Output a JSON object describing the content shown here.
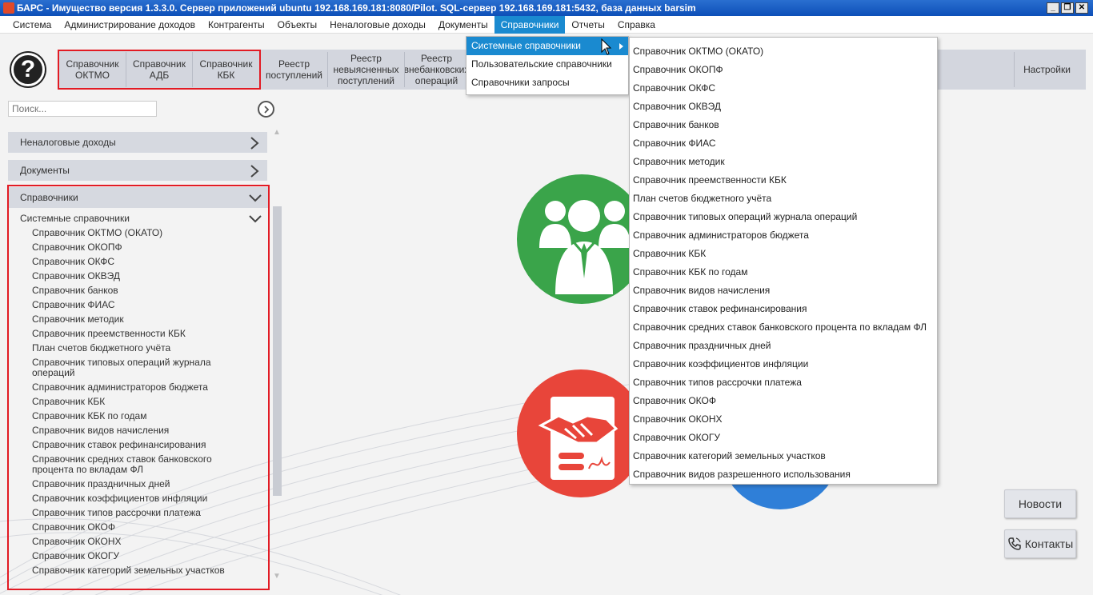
{
  "window": {
    "title": "БАРС - Имущество версия 1.3.3.0. Сервер приложений ubuntu 192.168.169.181:8080/Pilot. SQL-сервер 192.168.169.181:5432, база данных barsim",
    "minimize": "_",
    "restore": "❐",
    "close": "✕"
  },
  "menubar": {
    "items": [
      "Система",
      "Администрирование доходов",
      "Контрагенты",
      "Объекты",
      "Неналоговые доходы",
      "Документы",
      "Справочники",
      "Отчеты",
      "Справка"
    ]
  },
  "toolbar": {
    "help_icon": "?",
    "group_buttons": [
      "Справочник\nОКТМО",
      "Справочник\nАДБ",
      "Справочник\nКБК"
    ],
    "buttons": [
      "Реестр\nпоступлений",
      "Реестр\nневыясненных\nпоступлений",
      "Реестр\nвнебанковских\nопераций"
    ],
    "partial_label": "е",
    "settings": "Настройки"
  },
  "search": {
    "placeholder": "Поиск..."
  },
  "sidebar": {
    "nontax": "Неналоговые доходы",
    "documents": "Документы",
    "references": "Справочники",
    "system_refs": "Системные справочники",
    "items": [
      "Справочник ОКТМО (ОКАТО)",
      "Справочник ОКОПФ",
      "Справочник ОКФС",
      "Справочник ОКВЭД",
      "Справочник банков",
      "Справочник ФИАС",
      "Справочник методик",
      "Справочник преемственности КБК",
      "План счетов бюджетного учёта",
      "Справочник типовых операций журнала\nопераций",
      "Справочник администраторов бюджета",
      "Справочник КБК",
      "Справочник КБК по годам",
      "Справочник видов начисления",
      "Справочник ставок рефинансирования",
      "Справочник средних ставок банковского\nпроцента по вкладам ФЛ",
      "Справочник праздничных дней",
      "Справочник коэффициентов инфляции",
      "Справочник типов рассрочки платежа",
      "Справочник ОКОФ",
      "Справочник ОКОНХ",
      "Справочник ОКОГУ",
      "Справочник категорий земельных участков"
    ]
  },
  "menu_dropdown": {
    "items": [
      "Системные справочники",
      "Пользовательские справочники",
      "Справочники запросы"
    ]
  },
  "submenu": {
    "items": [
      "Справочник ОКТМО (ОКАТО)",
      "Справочник ОКОПФ",
      "Справочник ОКФС",
      "Справочник ОКВЭД",
      "Справочник банков",
      "Справочник ФИАС",
      "Справочник методик",
      "Справочник преемственности КБК",
      "План счетов бюджетного учёта",
      "Справочник типовых операций журнала операций",
      "Справочник администраторов бюджета",
      "Справочник КБК",
      "Справочник КБК по годам",
      "Справочник видов начисления",
      "Справочник ставок рефинансирования",
      "Справочник средних ставок банковского процента по вкладам ФЛ",
      "Справочник праздничных дней",
      "Справочник коэффициентов инфляции",
      "Справочник типов рассрочки платежа",
      "Справочник ОКОФ",
      "Справочник ОКОНХ",
      "Справочник ОКОГУ",
      "Справочник категорий земельных участков",
      "Справочник видов разрешенного использования"
    ]
  },
  "side_buttons": {
    "news": "Новости",
    "contacts": "Контакты"
  },
  "colors": {
    "accent": "#1a8ad0",
    "highlight": "#e21b24",
    "green": "#3aa44a",
    "red": "#e8453a",
    "blue": "#2f7fd8"
  }
}
